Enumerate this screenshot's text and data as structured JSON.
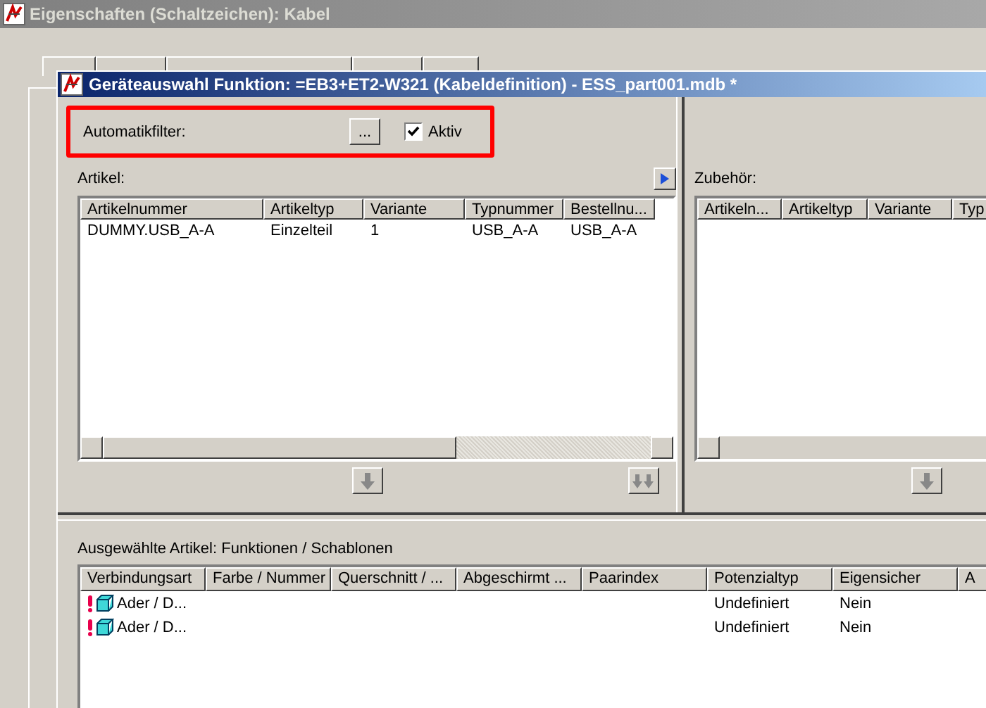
{
  "back_window": {
    "title": "Eigenschaften (Schaltzeichen): Kabel"
  },
  "dialog": {
    "title": "Geräteauswahl Funktion: =EB3+ET2-W321 (Kabeldefinition) - ESS_part001.mdb *"
  },
  "filter": {
    "label": "Automatikfilter:",
    "browse_button": "...",
    "active": {
      "label": "Aktiv",
      "checked": true
    }
  },
  "articles": {
    "label": "Artikel:",
    "columns": [
      "Artikelnummer",
      "Artikeltyp",
      "Variante",
      "Typnummer",
      "Bestellnu..."
    ],
    "rows": [
      {
        "cells": [
          "DUMMY.USB_A-A",
          "Einzelteil",
          "1",
          "USB_A-A",
          "USB_A-A"
        ],
        "selected": false
      }
    ]
  },
  "accessories": {
    "label": "Zubehör:",
    "columns": [
      "Artikeln...",
      "Artikeltyp",
      "Variante",
      "Typ"
    ]
  },
  "selected_articles": {
    "label": "Ausgewählte Artikel: Funktionen / Schablonen",
    "columns": [
      "Verbindungsart",
      "Farbe / Nummer",
      "Querschnitt / ...",
      "Abgeschirmt ...",
      "Paarindex",
      "Potenzialtyp",
      "Eigensicher",
      "A"
    ],
    "rows": [
      {
        "verbindungsart": "Ader / D...",
        "potenzialtyp": "Undefiniert",
        "eigensicher": "Nein",
        "warning": true,
        "selected": false
      },
      {
        "verbindungsart": "Ader / D...",
        "potenzialtyp": "Undefiniert",
        "eigensicher": "Nein",
        "warning": true,
        "selected": false
      }
    ]
  }
}
